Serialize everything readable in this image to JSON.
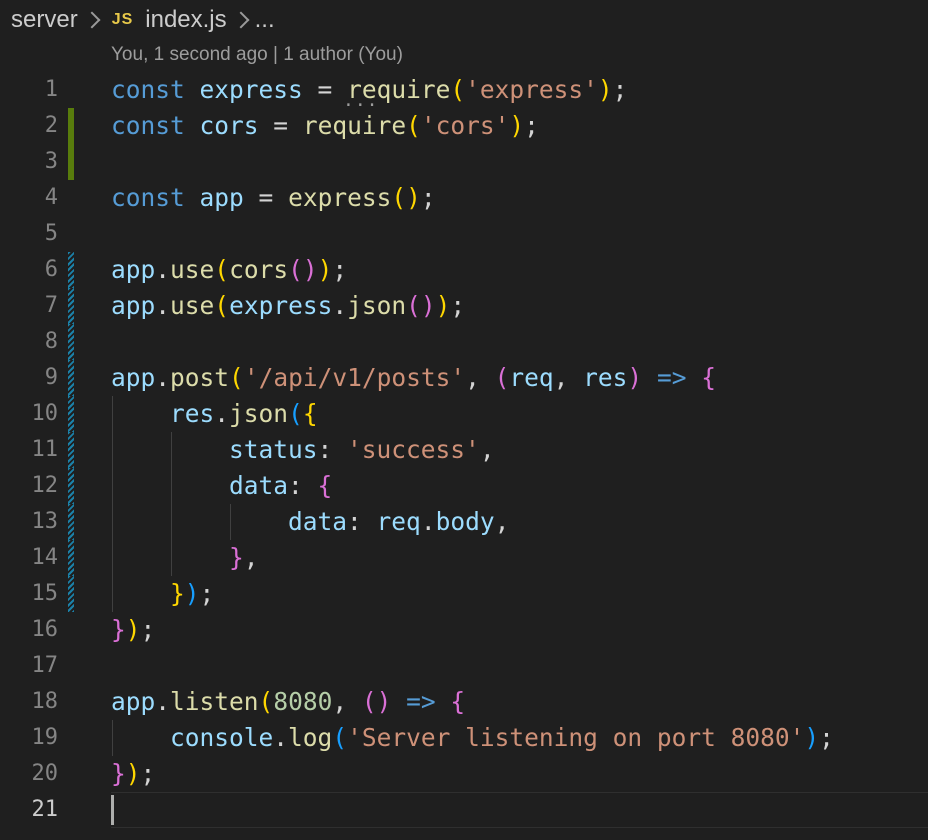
{
  "breadcrumb": {
    "folder": "server",
    "file_icon": "JS",
    "file": "index.js",
    "more": "..."
  },
  "blame": "You, 1 second ago | 1 author (You)",
  "hover_dots": "...",
  "colors": {
    "background": "#1f1f1f",
    "keyword": "#569cd6",
    "variable": "#9cdcfe",
    "function": "#dcdcaa",
    "string": "#ce9178",
    "number": "#b5cea8",
    "bracket1": "#ffd700",
    "bracket2": "#da70d6",
    "bracket3": "#179fff",
    "gutter_added": "#587c0c",
    "gutter_modified": "#1b81a8"
  },
  "lines": [
    {
      "n": "1",
      "gutter": "none",
      "tokens": [
        [
          "k",
          "const"
        ],
        [
          "p",
          " "
        ],
        [
          "v",
          "express"
        ],
        [
          "p",
          " = "
        ],
        [
          "f",
          "require"
        ],
        [
          "b1",
          "("
        ],
        [
          "s",
          "'express'"
        ],
        [
          "b1",
          ")"
        ],
        [
          "p",
          ";"
        ]
      ]
    },
    {
      "n": "2",
      "gutter": "added",
      "tokens": [
        [
          "k",
          "const"
        ],
        [
          "p",
          " "
        ],
        [
          "v",
          "cors"
        ],
        [
          "p",
          " = "
        ],
        [
          "f",
          "require"
        ],
        [
          "b1",
          "("
        ],
        [
          "s",
          "'cors'"
        ],
        [
          "b1",
          ")"
        ],
        [
          "p",
          ";"
        ]
      ]
    },
    {
      "n": "3",
      "gutter": "added",
      "tokens": []
    },
    {
      "n": "4",
      "gutter": "none",
      "tokens": [
        [
          "k",
          "const"
        ],
        [
          "p",
          " "
        ],
        [
          "v",
          "app"
        ],
        [
          "p",
          " = "
        ],
        [
          "f",
          "express"
        ],
        [
          "b1",
          "()"
        ],
        [
          "p",
          ";"
        ]
      ]
    },
    {
      "n": "5",
      "gutter": "none",
      "tokens": []
    },
    {
      "n": "6",
      "gutter": "modified",
      "tokens": [
        [
          "v",
          "app"
        ],
        [
          "p",
          "."
        ],
        [
          "f",
          "use"
        ],
        [
          "b1",
          "("
        ],
        [
          "f",
          "cors"
        ],
        [
          "b2",
          "()"
        ],
        [
          "b1",
          ")"
        ],
        [
          "p",
          ";"
        ]
      ]
    },
    {
      "n": "7",
      "gutter": "modified",
      "tokens": [
        [
          "v",
          "app"
        ],
        [
          "p",
          "."
        ],
        [
          "f",
          "use"
        ],
        [
          "b1",
          "("
        ],
        [
          "v",
          "express"
        ],
        [
          "p",
          "."
        ],
        [
          "f",
          "json"
        ],
        [
          "b2",
          "()"
        ],
        [
          "b1",
          ")"
        ],
        [
          "p",
          ";"
        ]
      ]
    },
    {
      "n": "8",
      "gutter": "modified",
      "tokens": []
    },
    {
      "n": "9",
      "gutter": "modified",
      "tokens": [
        [
          "v",
          "app"
        ],
        [
          "p",
          "."
        ],
        [
          "f",
          "post"
        ],
        [
          "b1",
          "("
        ],
        [
          "s",
          "'/api/v1/posts'"
        ],
        [
          "p",
          ", "
        ],
        [
          "b2",
          "("
        ],
        [
          "v",
          "req"
        ],
        [
          "p",
          ", "
        ],
        [
          "v",
          "res"
        ],
        [
          "b2",
          ")"
        ],
        [
          "p",
          " "
        ],
        [
          "k",
          "=>"
        ],
        [
          "p",
          " "
        ],
        [
          "b2",
          "{"
        ]
      ]
    },
    {
      "n": "10",
      "gutter": "modified",
      "indent": 1,
      "tokens": [
        [
          "p",
          "    "
        ],
        [
          "v",
          "res"
        ],
        [
          "p",
          "."
        ],
        [
          "f",
          "json"
        ],
        [
          "b3",
          "("
        ],
        [
          "b1",
          "{"
        ]
      ]
    },
    {
      "n": "11",
      "gutter": "modified",
      "indent": 2,
      "tokens": [
        [
          "p",
          "        "
        ],
        [
          "v",
          "status"
        ],
        [
          "p",
          ": "
        ],
        [
          "s",
          "'success'"
        ],
        [
          "p",
          ","
        ]
      ]
    },
    {
      "n": "12",
      "gutter": "modified",
      "indent": 2,
      "tokens": [
        [
          "p",
          "        "
        ],
        [
          "v",
          "data"
        ],
        [
          "p",
          ": "
        ],
        [
          "b2",
          "{"
        ]
      ]
    },
    {
      "n": "13",
      "gutter": "modified",
      "indent": 3,
      "tokens": [
        [
          "p",
          "            "
        ],
        [
          "v",
          "data"
        ],
        [
          "p",
          ": "
        ],
        [
          "v",
          "req"
        ],
        [
          "p",
          "."
        ],
        [
          "v",
          "body"
        ],
        [
          "p",
          ","
        ]
      ]
    },
    {
      "n": "14",
      "gutter": "modified",
      "indent": 2,
      "tokens": [
        [
          "p",
          "        "
        ],
        [
          "b2",
          "}"
        ],
        [
          "p",
          ","
        ]
      ]
    },
    {
      "n": "15",
      "gutter": "modified",
      "indent": 1,
      "tokens": [
        [
          "p",
          "    "
        ],
        [
          "b1",
          "}"
        ],
        [
          "b3",
          ")"
        ],
        [
          "p",
          ";"
        ]
      ]
    },
    {
      "n": "16",
      "gutter": "none",
      "tokens": [
        [
          "b2",
          "}"
        ],
        [
          "b1",
          ")"
        ],
        [
          "p",
          ";"
        ]
      ]
    },
    {
      "n": "17",
      "gutter": "none",
      "tokens": []
    },
    {
      "n": "18",
      "gutter": "none",
      "tokens": [
        [
          "v",
          "app"
        ],
        [
          "p",
          "."
        ],
        [
          "f",
          "listen"
        ],
        [
          "b1",
          "("
        ],
        [
          "n",
          "8080"
        ],
        [
          "p",
          ", "
        ],
        [
          "b2",
          "()"
        ],
        [
          "p",
          " "
        ],
        [
          "k",
          "=>"
        ],
        [
          "p",
          " "
        ],
        [
          "b2",
          "{"
        ]
      ]
    },
    {
      "n": "19",
      "gutter": "none",
      "indent": 1,
      "tokens": [
        [
          "p",
          "    "
        ],
        [
          "v",
          "console"
        ],
        [
          "p",
          "."
        ],
        [
          "f",
          "log"
        ],
        [
          "b3",
          "("
        ],
        [
          "s",
          "'Server listening on port 8080'"
        ],
        [
          "b3",
          ")"
        ],
        [
          "p",
          ";"
        ]
      ]
    },
    {
      "n": "20",
      "gutter": "none",
      "tokens": [
        [
          "b2",
          "}"
        ],
        [
          "b1",
          ")"
        ],
        [
          "p",
          ";"
        ]
      ]
    },
    {
      "n": "21",
      "gutter": "none",
      "active": true,
      "tokens": []
    }
  ]
}
